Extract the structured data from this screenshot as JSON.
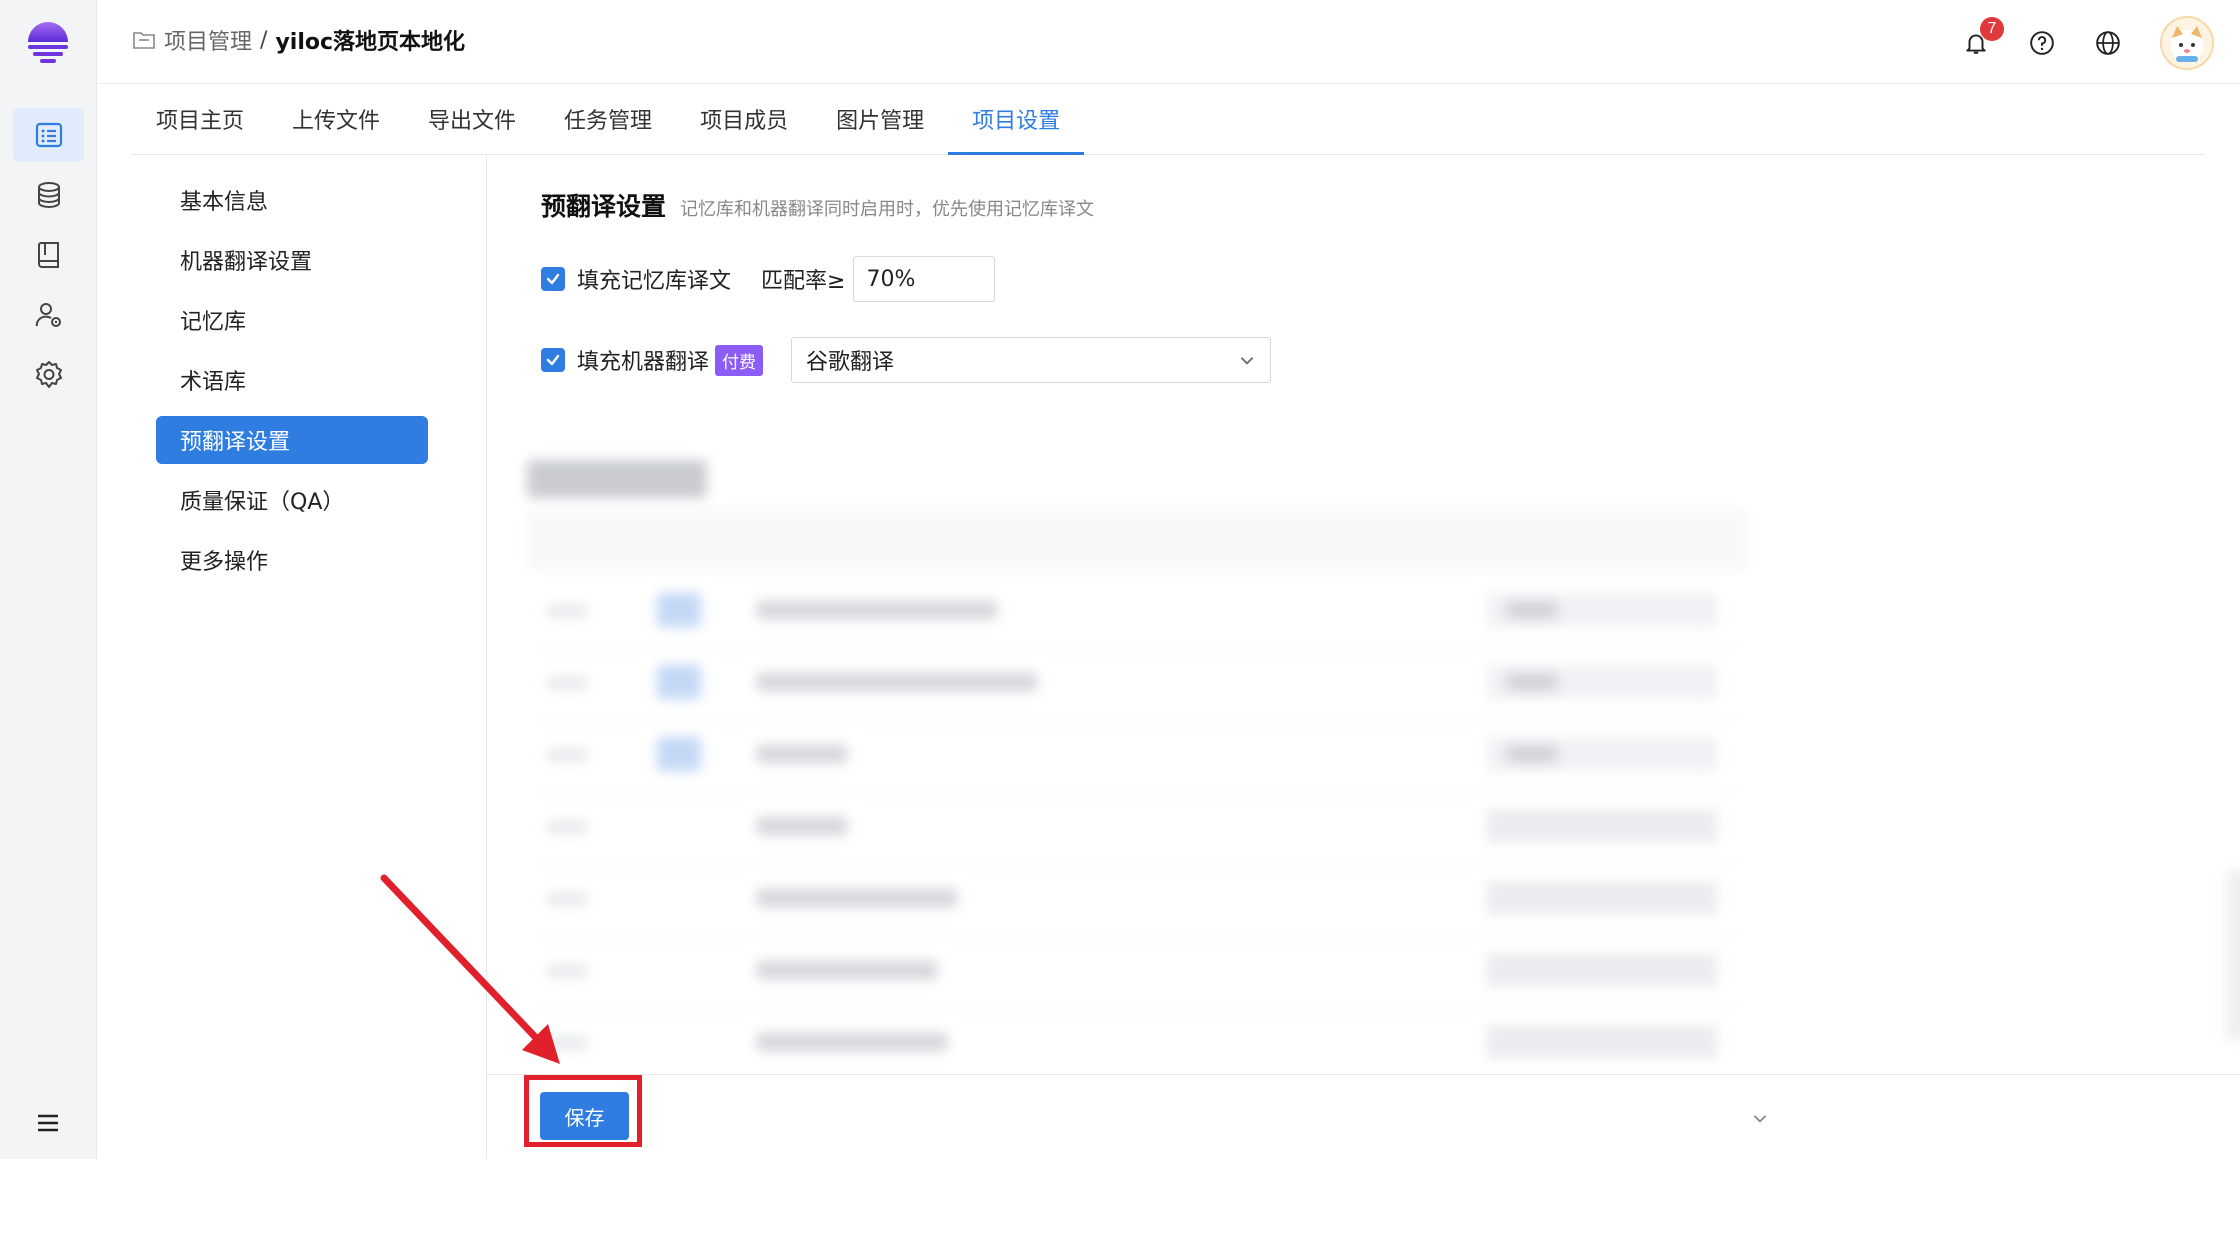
{
  "breadcrumb": {
    "parent": "项目管理",
    "separator": "/",
    "current": "yiloc落地页本地化"
  },
  "header": {
    "notification_count": "7"
  },
  "tabs": [
    {
      "label": "项目主页"
    },
    {
      "label": "上传文件"
    },
    {
      "label": "导出文件"
    },
    {
      "label": "任务管理"
    },
    {
      "label": "项目成员"
    },
    {
      "label": "图片管理"
    },
    {
      "label": "项目设置",
      "active": true
    }
  ],
  "settings_menu": [
    {
      "label": "基本信息"
    },
    {
      "label": "机器翻译设置"
    },
    {
      "label": "记忆库"
    },
    {
      "label": "术语库"
    },
    {
      "label": "预翻译设置",
      "active": true
    },
    {
      "label": "质量保证（QA）"
    },
    {
      "label": "更多操作"
    }
  ],
  "pretranslate": {
    "title": "预翻译设置",
    "hint": "记忆库和机器翻译同时启用时，优先使用记忆库译文",
    "fill_tm_label": "填充记忆库译文",
    "fill_tm_checked": true,
    "match_label": "匹配率≥",
    "match_value": "70%",
    "fill_mt_label": "填充机器翻译",
    "fill_mt_checked": true,
    "paid_tag": "付费",
    "engine_value": "谷歌翻译"
  },
  "footer": {
    "save_label": "保存"
  },
  "colors": {
    "accent": "#2f7de1",
    "paid_tag": "#8b5cf6",
    "annotation": "#e0202a"
  }
}
